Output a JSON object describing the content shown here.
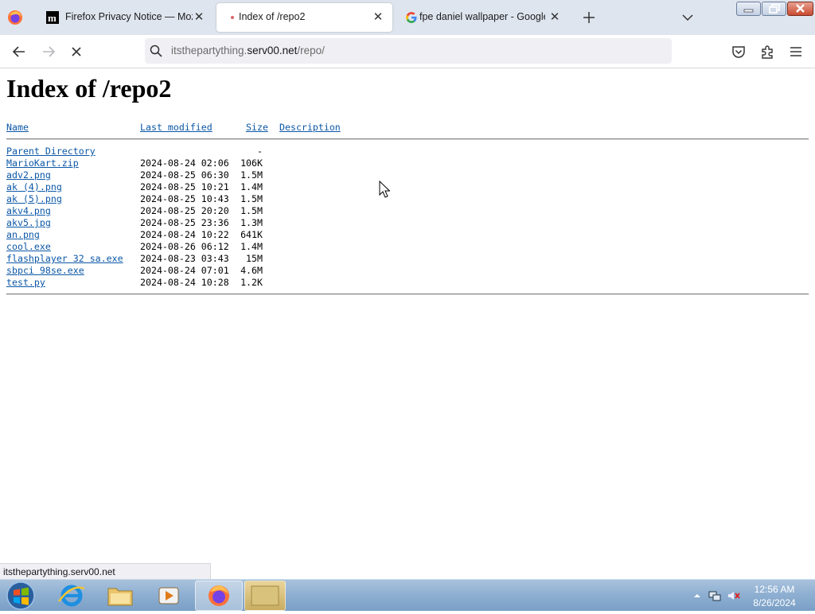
{
  "browser": {
    "tabs": [
      {
        "title": "Firefox Privacy Notice — Mozill",
        "close": "✕"
      },
      {
        "title": "Index of /repo2",
        "close": "✕"
      },
      {
        "title": "fpe daniel wallpaper - Google S",
        "close": "✕"
      }
    ],
    "url": {
      "prefix": "itsthepartything.",
      "domain": "serv00.net",
      "path": "/repo/"
    },
    "status_text": "itsthepartything.serv00.net"
  },
  "page": {
    "title": "Index of /repo2",
    "columns": {
      "name": "Name",
      "modified": "Last modified",
      "size": "Size",
      "description": "Description"
    },
    "parent": {
      "name": "Parent Directory",
      "size": "-"
    },
    "files": [
      {
        "name": "MarioKart.zip",
        "modified": "2024-08-24 02:06",
        "size": "106K"
      },
      {
        "name": "adv2.png",
        "modified": "2024-08-25 06:30",
        "size": "1.5M"
      },
      {
        "name": "ak (4).png",
        "modified": "2024-08-25 10:21",
        "size": "1.4M"
      },
      {
        "name": "ak (5).png",
        "modified": "2024-08-25 10:43",
        "size": "1.5M"
      },
      {
        "name": "akv4.png",
        "modified": "2024-08-25 20:20",
        "size": "1.5M"
      },
      {
        "name": "akv5.jpg",
        "modified": "2024-08-25 23:36",
        "size": "1.3M"
      },
      {
        "name": "an.png",
        "modified": "2024-08-24 10:22",
        "size": "641K"
      },
      {
        "name": "cool.exe",
        "modified": "2024-08-26 06:12",
        "size": "1.4M"
      },
      {
        "name": "flashplayer 32 sa.exe",
        "modified": "2024-08-23 03:43",
        "size": "15M"
      },
      {
        "name": "sbpci 98se.exe",
        "modified": "2024-08-24 07:01",
        "size": "4.6M"
      },
      {
        "name": "test.py",
        "modified": "2024-08-24 10:28",
        "size": "1.2K"
      }
    ]
  },
  "taskbar": {
    "clock_time": "12:56 AM",
    "clock_date": "8/26/2024"
  },
  "colors": {
    "link": "#0b57a6",
    "tabstrip": "#dfe5ee",
    "taskbar": "#8fb0d2"
  }
}
